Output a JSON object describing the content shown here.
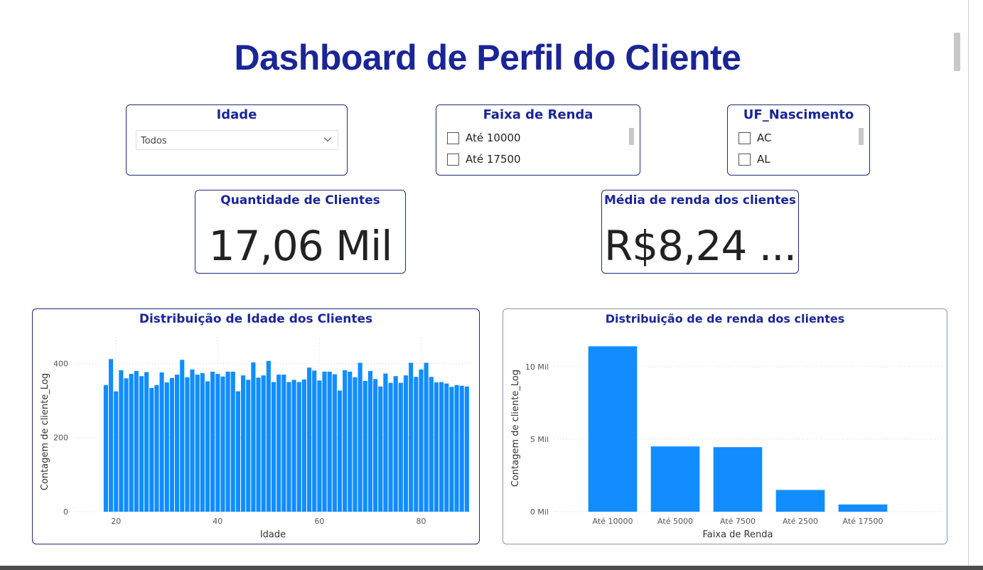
{
  "title": "Dashboard de Perfil do Cliente",
  "slicers": {
    "idade": {
      "title": "Idade",
      "selected": "Todos",
      "icon": "chevron-down-icon"
    },
    "faixa_renda": {
      "title": "Faixa de Renda",
      "items": [
        "Até 10000",
        "Até 17500"
      ]
    },
    "uf": {
      "title": "UF_Nascimento",
      "items": [
        "AC",
        "AL"
      ]
    }
  },
  "kpis": {
    "quantidade": {
      "title": "Quantidade de Clientes",
      "value": "17,06 Mil"
    },
    "media_renda": {
      "title": "Média de renda dos clientes",
      "value": "R$8,24 ..."
    }
  },
  "colors": {
    "accent": "#1a2596",
    "bar": "#118dff"
  },
  "chart_data": [
    {
      "type": "bar",
      "title": "Distribuição de Idade dos Clientes",
      "xlabel": "Idade",
      "ylabel": "Contagem de cliente_Log",
      "xlim": [
        12,
        90
      ],
      "ylim": [
        0,
        470
      ],
      "xticks": [
        20,
        40,
        60,
        80
      ],
      "yticks": [
        0,
        200,
        400
      ],
      "ytick_labels": [
        "0",
        "200",
        "400"
      ],
      "x": [
        18,
        19,
        20,
        21,
        22,
        23,
        24,
        25,
        26,
        27,
        28,
        29,
        30,
        31,
        32,
        33,
        34,
        35,
        36,
        37,
        38,
        39,
        40,
        41,
        42,
        43,
        44,
        45,
        46,
        47,
        48,
        49,
        50,
        51,
        52,
        53,
        54,
        55,
        56,
        57,
        58,
        59,
        60,
        61,
        62,
        63,
        64,
        65,
        66,
        67,
        68,
        69,
        70,
        71,
        72,
        73,
        74,
        75,
        76,
        77,
        78,
        79,
        80,
        81,
        82,
        83,
        84,
        85,
        86,
        87,
        88,
        89
      ],
      "values": [
        342,
        412,
        325,
        382,
        360,
        372,
        380,
        366,
        377,
        334,
        342,
        376,
        349,
        361,
        370,
        410,
        363,
        384,
        370,
        374,
        352,
        378,
        372,
        365,
        378,
        378,
        325,
        368,
        356,
        403,
        362,
        368,
        407,
        350,
        370,
        370,
        350,
        356,
        350,
        357,
        389,
        381,
        354,
        378,
        378,
        371,
        327,
        382,
        378,
        363,
        402,
        353,
        380,
        358,
        338,
        373,
        348,
        366,
        348,
        368,
        402,
        364,
        384,
        402,
        364,
        349,
        350,
        346,
        337,
        342,
        340,
        338
      ]
    },
    {
      "type": "bar",
      "title": "Distribuição de de renda dos clientes",
      "xlabel": "Faixa de Renda",
      "ylabel": "Contagem de cliente_Log",
      "categories": [
        "Até 10000",
        "Até 5000",
        "Até 7500",
        "Até 2500",
        "Até 17500"
      ],
      "values": [
        11.4,
        4.5,
        4.45,
        1.5,
        0.5
      ],
      "ylim": [
        0,
        12
      ],
      "yticks": [
        0,
        5,
        10
      ],
      "ytick_labels": [
        "0 Mil",
        "5 Mil",
        "10 Mil"
      ]
    }
  ]
}
